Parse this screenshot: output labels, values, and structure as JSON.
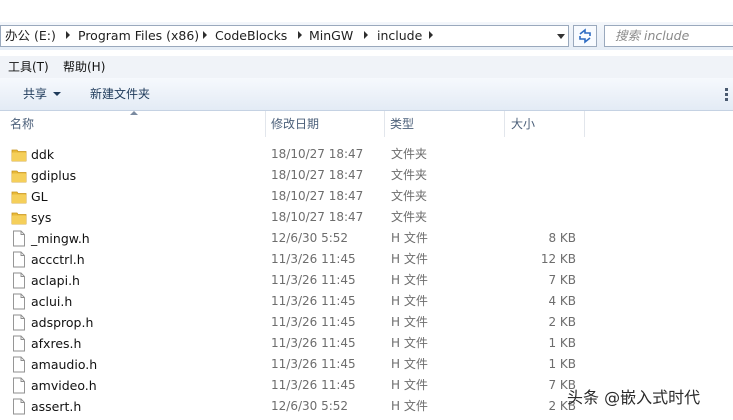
{
  "address_bar": {
    "breadcrumbs": [
      "办公 (E:)",
      "Program Files (x86)",
      "CodeBlocks",
      "MinGW",
      "include"
    ],
    "search_placeholder": "搜索 include"
  },
  "menu": {
    "items": [
      "工具(T)",
      "帮助(H)"
    ]
  },
  "toolbar": {
    "share_label": "共享",
    "new_folder_label": "新建文件夹"
  },
  "columns": {
    "name": "名称",
    "modified": "修改日期",
    "type": "类型",
    "size": "大小"
  },
  "files": [
    {
      "name": "ddk",
      "modified": "18/10/27 18:47",
      "type": "文件夹",
      "size": "",
      "icon": "folder-icon"
    },
    {
      "name": "gdiplus",
      "modified": "18/10/27 18:47",
      "type": "文件夹",
      "size": "",
      "icon": "folder-icon"
    },
    {
      "name": "GL",
      "modified": "18/10/27 18:47",
      "type": "文件夹",
      "size": "",
      "icon": "folder-icon"
    },
    {
      "name": "sys",
      "modified": "18/10/27 18:47",
      "type": "文件夹",
      "size": "",
      "icon": "folder-icon"
    },
    {
      "name": "_mingw.h",
      "modified": "12/6/30 5:52",
      "type": "H 文件",
      "size": "8 KB",
      "icon": "file-icon"
    },
    {
      "name": "accctrl.h",
      "modified": "11/3/26 11:45",
      "type": "H 文件",
      "size": "12 KB",
      "icon": "file-icon"
    },
    {
      "name": "aclapi.h",
      "modified": "11/3/26 11:45",
      "type": "H 文件",
      "size": "7 KB",
      "icon": "file-icon"
    },
    {
      "name": "aclui.h",
      "modified": "11/3/26 11:45",
      "type": "H 文件",
      "size": "4 KB",
      "icon": "file-icon"
    },
    {
      "name": "adsprop.h",
      "modified": "11/3/26 11:45",
      "type": "H 文件",
      "size": "2 KB",
      "icon": "file-icon"
    },
    {
      "name": "afxres.h",
      "modified": "11/3/26 11:45",
      "type": "H 文件",
      "size": "1 KB",
      "icon": "file-icon"
    },
    {
      "name": "amaudio.h",
      "modified": "11/3/26 11:45",
      "type": "H 文件",
      "size": "1 KB",
      "icon": "file-icon"
    },
    {
      "name": "amvideo.h",
      "modified": "11/3/26 11:45",
      "type": "H 文件",
      "size": "7 KB",
      "icon": "file-icon"
    },
    {
      "name": "assert.h",
      "modified": "12/6/30 5:52",
      "type": "H 文件",
      "size": "2 KB",
      "icon": "file-icon"
    }
  ],
  "watermark": {
    "text": "头条 @嵌入式时代"
  }
}
